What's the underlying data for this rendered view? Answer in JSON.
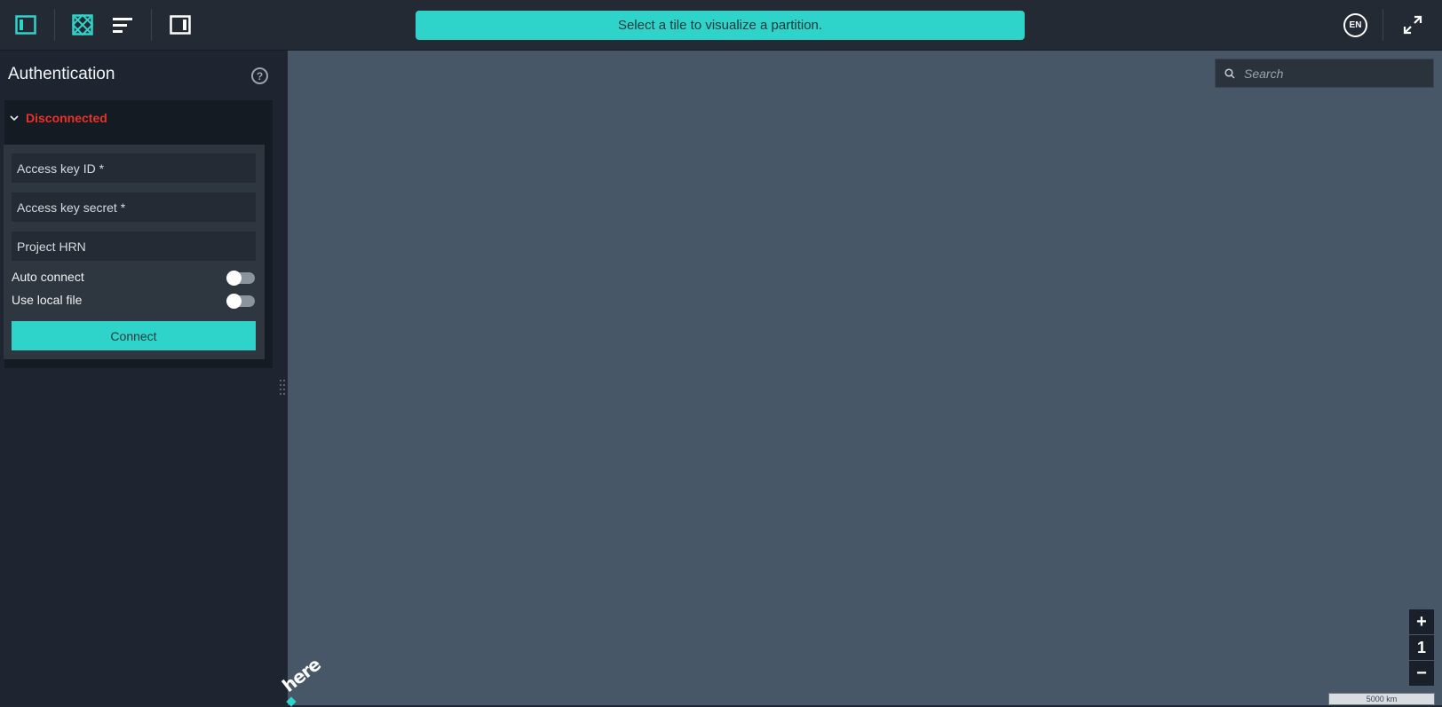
{
  "topbar": {
    "banner_text": "Select a tile to visualize a partition.",
    "language": "EN",
    "icons": [
      "left-panel-toggle-icon",
      "tile-grid-icon",
      "layers-list-icon",
      "right-panel-toggle-icon",
      "fullscreen-icon"
    ],
    "accent_color": "#2ed3c9"
  },
  "sidebar": {
    "title": "Authentication",
    "help_icon": "?",
    "status": "Disconnected",
    "status_color": "#e8322b",
    "fields": {
      "access_key_id": "Access key ID *",
      "access_key_secret": "Access key secret *",
      "project_hrn": "Project HRN"
    },
    "toggles": {
      "auto_connect": "Auto connect",
      "use_local_file": "Use local file"
    },
    "connect_label": "Connect"
  },
  "map": {
    "search_placeholder": "Search",
    "zoom_in": "+",
    "zoom_level": "1",
    "zoom_out": "−",
    "logo": "here",
    "scale_label": "5000 km"
  }
}
